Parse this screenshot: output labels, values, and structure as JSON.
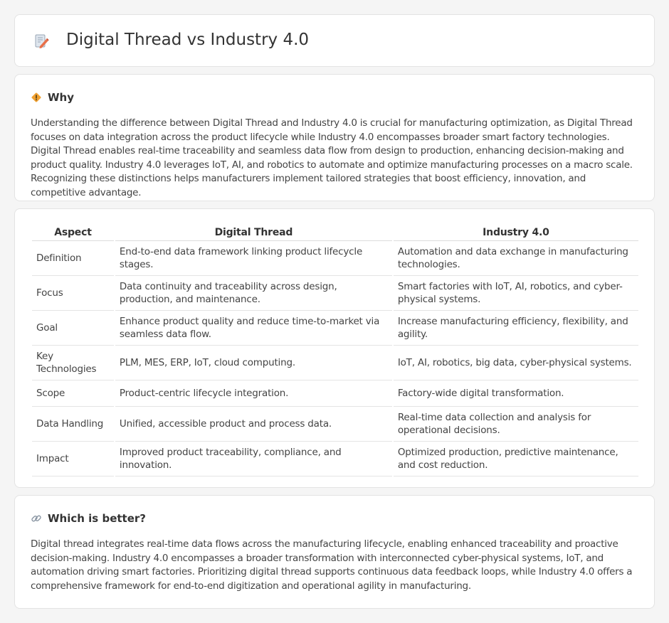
{
  "header": {
    "title": "Digital Thread vs Industry 4.0",
    "icon": "document-pencil-icon"
  },
  "why": {
    "title": "Why",
    "icon": "warning-sign-icon",
    "text": "Understanding the difference between Digital Thread and Industry 4.0 is crucial for manufacturing optimization, as Digital Thread focuses on data integration across the product lifecycle while Industry 4.0 encompasses broader smart factory technologies. Digital Thread enables real-time traceability and seamless data flow from design to production, enhancing decision-making and product quality. Industry 4.0 leverages IoT, AI, and robotics to automate and optimize manufacturing processes on a macro scale. Recognizing these distinctions helps manufacturers implement tailored strategies that boost efficiency, innovation, and competitive advantage."
  },
  "comparison": {
    "headers": [
      "Aspect",
      "Digital Thread",
      "Industry 4.0"
    ],
    "rows": [
      [
        "Definition",
        "End-to-end data framework linking product lifecycle stages.",
        "Automation and data exchange in manufacturing technologies."
      ],
      [
        "Focus",
        "Data continuity and traceability across design, production, and maintenance.",
        "Smart factories with IoT, AI, robotics, and cyber-physical systems."
      ],
      [
        "Goal",
        "Enhance product quality and reduce time-to-market via seamless data flow.",
        "Increase manufacturing efficiency, flexibility, and agility."
      ],
      [
        "Key Technologies",
        "PLM, MES, ERP, IoT, cloud computing.",
        "IoT, AI, robotics, big data, cyber-physical systems."
      ],
      [
        "Scope",
        "Product-centric lifecycle integration.",
        "Factory-wide digital transformation."
      ],
      [
        "Data Handling",
        "Unified, accessible product and process data.",
        "Real-time data collection and analysis for operational decisions."
      ],
      [
        "Impact",
        "Improved product traceability, compliance, and innovation.",
        "Optimized production, predictive maintenance, and cost reduction."
      ]
    ]
  },
  "better": {
    "title": "Which is better?",
    "icon": "link-icon",
    "text": "Digital thread integrates real-time data flows across the manufacturing lifecycle, enabling enhanced traceability and proactive decision-making. Industry 4.0 encompasses a broader transformation with interconnected cyber-physical systems, IoT, and automation driving smart factories. Prioritizing digital thread supports continuous data feedback loops, while Industry 4.0 offers a comprehensive framework for end-to-end digitization and operational agility in manufacturing."
  },
  "colors": {
    "background": "#f5f5f5",
    "card": "#ffffff",
    "warning_icon": "#f0a030",
    "pencil_icon": "#e8704a"
  }
}
